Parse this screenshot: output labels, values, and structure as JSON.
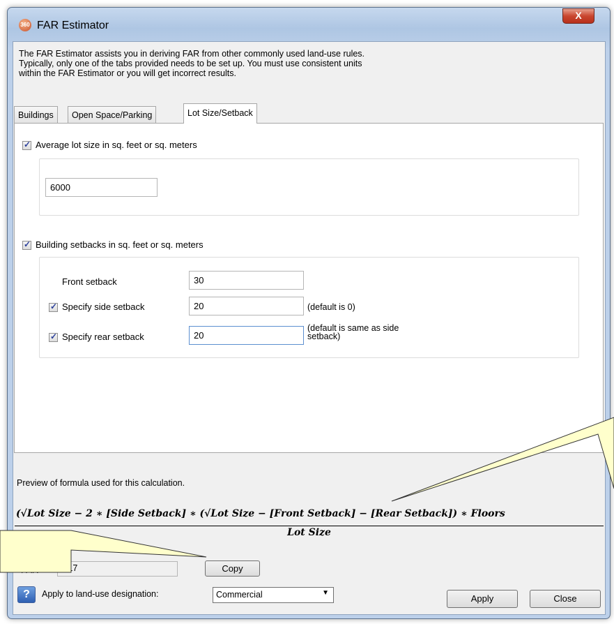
{
  "window": {
    "title": "FAR Estimator",
    "close_label": "X",
    "app_icon_text": "360"
  },
  "intro": {
    "lines": [
      "The FAR Estimator assists you in deriving FAR from other commonly used land-use rules.",
      "Typically, only one of the tabs provided needs to be set up.  You must use consistent units",
      "within the FAR Estimator or you will get incorrect results."
    ]
  },
  "tabs": [
    {
      "label": "Buildings",
      "active": false
    },
    {
      "label": "Open Space/Parking",
      "active": false
    },
    {
      "label": "Lot Size/Setback",
      "active": true
    }
  ],
  "lot_size": {
    "label": "Average lot size in sq. feet or sq. meters",
    "checked": true,
    "value": "6000"
  },
  "setbacks": {
    "label": "Building setbacks in sq. feet or sq. meters",
    "checked": true,
    "front": {
      "label": "Front setback",
      "value": "30"
    },
    "side": {
      "label": "Specify side setback",
      "checked": true,
      "value": "20",
      "note": "(default is 0)"
    },
    "rear": {
      "label": "Specify rear setback",
      "checked": true,
      "value": "20",
      "note_line1": "(default is same as side",
      "note_line2": "setback)"
    }
  },
  "preview": {
    "label": "Preview of formula used for this calculation.",
    "numerator": "(√Lot Size − 2 ∗ [Side Setback] ∗ (√Lot Size − [Front Setback] − [Rear Setback]) ∗ Floors",
    "denominator": "Lot Size"
  },
  "far": {
    "label": "FAR",
    "value": "0.17",
    "copy_label": "Copy"
  },
  "bottom": {
    "help_icon": "?",
    "apply_to_label": "Apply to land-use designation:",
    "designation": "Commercial",
    "apply_label": "Apply",
    "close_label": "Close"
  },
  "colors": {
    "title_bar": "#aec6e3",
    "close_button": "#c9462f",
    "callout_fill": "#ffffcc"
  }
}
